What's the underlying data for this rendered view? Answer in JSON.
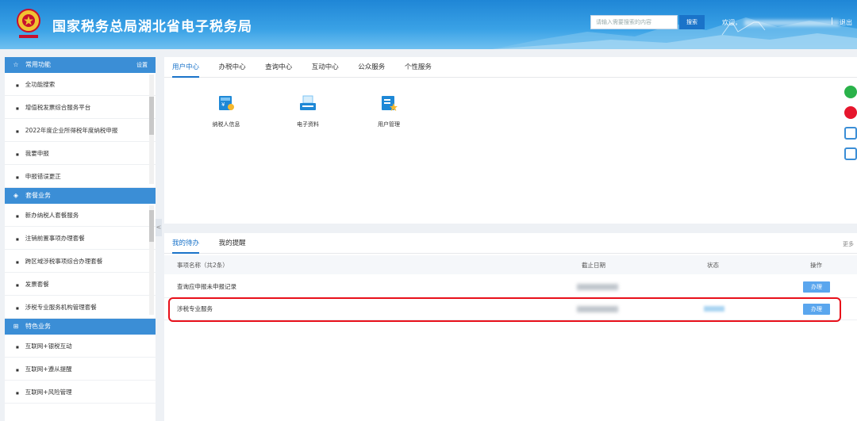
{
  "header": {
    "title": "国家税务总局湖北省电子税务局",
    "search_placeholder": "请输入需要搜索的内容",
    "search_button": "搜索",
    "welcome": "欢迎，",
    "separator": "|",
    "logout": "退出"
  },
  "sidebar": {
    "sections": [
      {
        "title": "常用功能",
        "icon": "star-outline-icon",
        "action": "设置",
        "items": [
          "全功能搜索",
          "增值税发票综合服务平台",
          "2022年度企业所得税年度纳税申报",
          "我要申报",
          "申报错误更正"
        ]
      },
      {
        "title": "套餐业务",
        "icon": "layers-icon",
        "items": [
          "新办纳税人套餐服务",
          "注销前置事项办理套餐",
          "跨区域涉税事项综合办理套餐",
          "发票套餐",
          "涉税专业服务机构管理套餐"
        ]
      },
      {
        "title": "特色业务",
        "icon": "grid-icon",
        "items": [
          "互联网+银税互动",
          "互联网+遵从提醒",
          "互联网+风险管理"
        ]
      }
    ],
    "collapse_glyph": "<"
  },
  "main": {
    "tabs": [
      {
        "label": "用户中心",
        "active": true
      },
      {
        "label": "办税中心",
        "active": false
      },
      {
        "label": "查询中心",
        "active": false
      },
      {
        "label": "互动中心",
        "active": false
      },
      {
        "label": "公众服务",
        "active": false
      },
      {
        "label": "个性服务",
        "active": false
      }
    ],
    "functions": [
      {
        "label": "纳税人信息",
        "icon": "taxpayer-info-icon"
      },
      {
        "label": "电子资料",
        "icon": "electronic-documents-icon"
      },
      {
        "label": "用户管理",
        "icon": "user-management-icon"
      }
    ]
  },
  "tasks": {
    "tabs": [
      {
        "label": "我的待办",
        "active": true
      },
      {
        "label": "我的提醒",
        "active": false
      }
    ],
    "more": "更多",
    "columns": {
      "name": "事项名称（共2条）",
      "deadline": "截止日期",
      "status": "状态",
      "action": "操作"
    },
    "rows": [
      {
        "name": "查询应申报未申报记录",
        "action": "办理"
      },
      {
        "name": "涉税专业服务",
        "action": "办理"
      }
    ]
  },
  "colors": {
    "header_blue": "#1f86d6",
    "accent_blue": "#1a73c9",
    "sidebar_header": "#3b8ed6",
    "button_blue": "#5aa6ee",
    "highlight_red": "#e8101a"
  }
}
